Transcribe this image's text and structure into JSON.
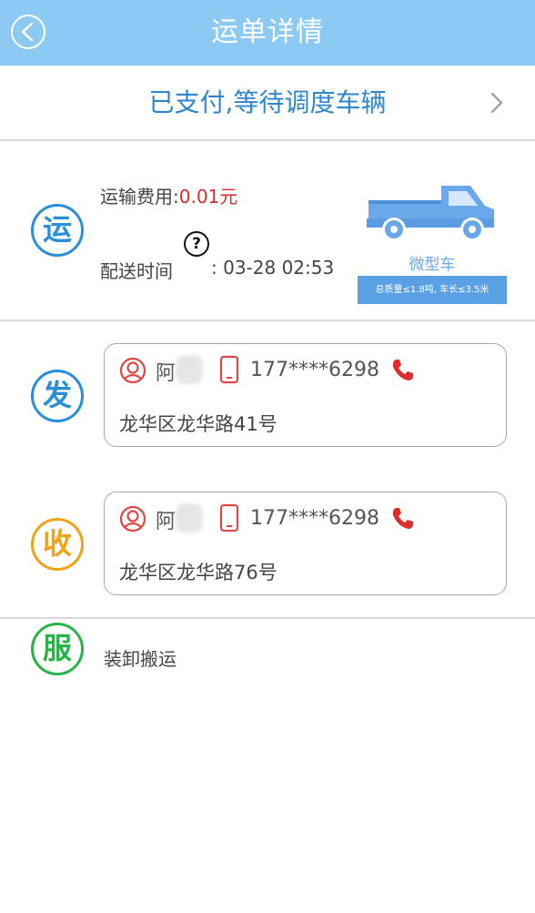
{
  "header": {
    "title": "运单详情"
  },
  "status": {
    "text": "已支付,等待调度车辆"
  },
  "transport": {
    "badge": "运",
    "fee_label": "运输费用:",
    "fee_value": "0.01元",
    "time_label": "配送时间",
    "time_value": ":  03-28 02:53",
    "help_glyph": "?",
    "vehicle_name": "微型车",
    "vehicle_spec": "总质量≤1.8吨, 车长≤3.5米"
  },
  "sender": {
    "badge": "发",
    "name": "阿",
    "phone": "177****6298",
    "address": "龙华区龙华路41号"
  },
  "receiver": {
    "badge": "收",
    "name": "阿",
    "phone": "177****6298",
    "address": "龙华区龙华路76号"
  },
  "service": {
    "badge": "服",
    "text": "装卸搬运"
  },
  "colors": {
    "header": "#8ccaf3",
    "accent_blue": "#2a8ed9",
    "orange": "#efa317",
    "green": "#27b54a",
    "red": "#e02b2b"
  }
}
